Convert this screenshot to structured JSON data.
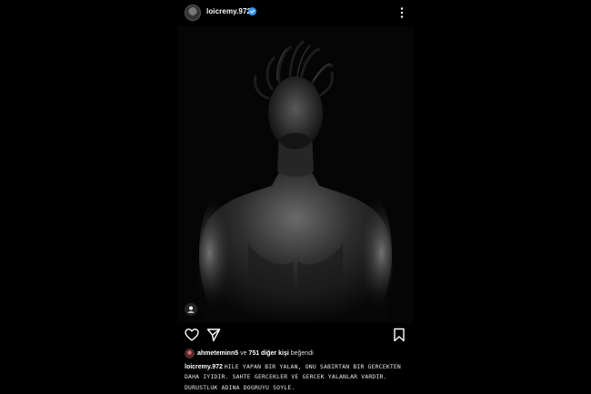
{
  "post": {
    "username": "loicremy.972",
    "verified": true,
    "avatar_icon": "profile-avatar",
    "more_icon": "more-vertical-icon"
  },
  "photo": {
    "alt_icon": "person-tag-icon"
  },
  "actions": {
    "like_icon": "heart-icon",
    "share_icon": "send-icon",
    "save_icon": "bookmark-icon"
  },
  "likes": {
    "liker": "ahmeteminn5",
    "connector": " ve ",
    "others": "751 diğer kişi",
    "suffix": " beğendi"
  },
  "caption": {
    "username": "loicremy.972",
    "text": "HILE YAPAN BIR YALAN, ONU SABIRTAN BIR GERCEKTEN DAHA IYIDIR. SAHTE GERCEKLER VE GERCEK YALANLAR VARDIR. DURUSTLUK ADINA DOGRUYU SOYLE."
  },
  "colors": {
    "background": "#000000",
    "text": "#f5f5f5",
    "verified_badge": "#3897f0"
  }
}
